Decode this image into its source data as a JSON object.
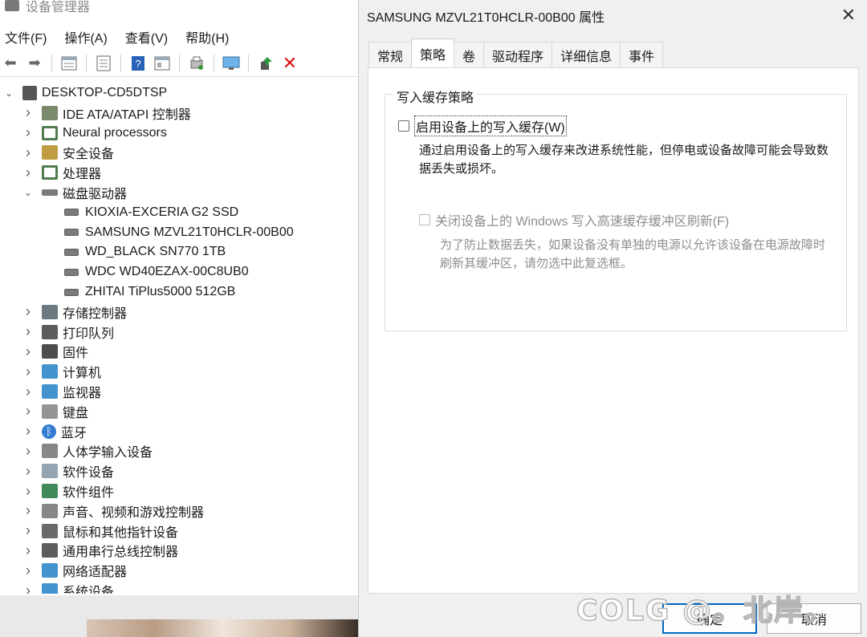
{
  "device_manager": {
    "title": "设备管理器",
    "menu": [
      "文件(F)",
      "操作(A)",
      "查看(V)",
      "帮助(H)"
    ],
    "toolbar_icons": [
      "back-arrow-icon",
      "forward-arrow-icon",
      "properties-icon",
      "update-icon",
      "help-icon",
      "view-icon",
      "scan-icon",
      "monitor-icon",
      "enable-icon",
      "remove-icon"
    ],
    "root": "DESKTOP-CD5DTSP",
    "categories": [
      {
        "label": "IDE ATA/ATAPI 控制器",
        "icon": "ide-controller-icon",
        "color": "#6b7d5a"
      },
      {
        "label": "Neural processors",
        "icon": "chip-icon",
        "color": "#3f6e3f"
      },
      {
        "label": "安全设备",
        "icon": "key-icon",
        "color": "#b8942f"
      },
      {
        "label": "处理器",
        "icon": "cpu-icon",
        "color": "#3f6e3f"
      },
      {
        "label": "磁盘驱动器",
        "icon": "disk-icon",
        "color": "#6b6b6b",
        "expanded": true,
        "children": [
          "KIOXIA-EXCERIA G2 SSD",
          "SAMSUNG MZVL21T0HCLR-00B00",
          "WD_BLACK SN770 1TB",
          "WDC WD40EZAX-00C8UB0",
          "ZHITAI TiPlus5000 512GB"
        ]
      },
      {
        "label": "存储控制器",
        "icon": "storage-controller-icon",
        "color": "#5b6b72"
      },
      {
        "label": "打印队列",
        "icon": "printer-icon",
        "color": "#4a4a4a"
      },
      {
        "label": "固件",
        "icon": "firmware-icon",
        "color": "#3a3a3a"
      },
      {
        "label": "计算机",
        "icon": "computer-icon",
        "color": "#2f88c8"
      },
      {
        "label": "监视器",
        "icon": "monitor-icon",
        "color": "#2f88c8"
      },
      {
        "label": "键盘",
        "icon": "keyboard-icon",
        "color": "#8a8a8a"
      },
      {
        "label": "蓝牙",
        "icon": "bluetooth-icon",
        "color": "#1f6fcf"
      },
      {
        "label": "人体学输入设备",
        "icon": "hid-icon",
        "color": "#7a7a7a"
      },
      {
        "label": "软件设备",
        "icon": "software-device-icon",
        "color": "#8a9aa8"
      },
      {
        "label": "软件组件",
        "icon": "software-component-icon",
        "color": "#2e7d4a"
      },
      {
        "label": "声音、视频和游戏控制器",
        "icon": "speaker-icon",
        "color": "#7a7a7a"
      },
      {
        "label": "鼠标和其他指针设备",
        "icon": "mouse-icon",
        "color": "#5a5a5a"
      },
      {
        "label": "通用串行总线控制器",
        "icon": "usb-icon",
        "color": "#4a4a4a"
      },
      {
        "label": "网络适配器",
        "icon": "network-icon",
        "color": "#2f88c8"
      },
      {
        "label": "系统设备",
        "icon": "system-icon",
        "color": "#2f88c8"
      }
    ]
  },
  "dialog": {
    "title": "SAMSUNG MZVL21T0HCLR-00B00 属性",
    "tabs": [
      "常规",
      "策略",
      "卷",
      "驱动程序",
      "详细信息",
      "事件"
    ],
    "active_tab": "策略",
    "group_title": "写入缓存策略",
    "option1_label": "启用设备上的写入缓存(W)",
    "option1_checked": false,
    "option1_desc": "通过启用设备上的写入缓存来改进系统性能，但停电或设备故障可能会导致数据丢失或损坏。",
    "option2_label": "关闭设备上的 Windows 写入高速缓存缓冲区刷新(F)",
    "option2_checked": false,
    "option2_enabled": false,
    "option2_desc": "为了防止数据丢失，如果设备没有单独的电源以允许该设备在电源故障时刷新其缓冲区，请勿选中此复选框。",
    "ok_label": "确定",
    "cancel_label": "取消"
  },
  "watermark": "COLG @。北岸。"
}
